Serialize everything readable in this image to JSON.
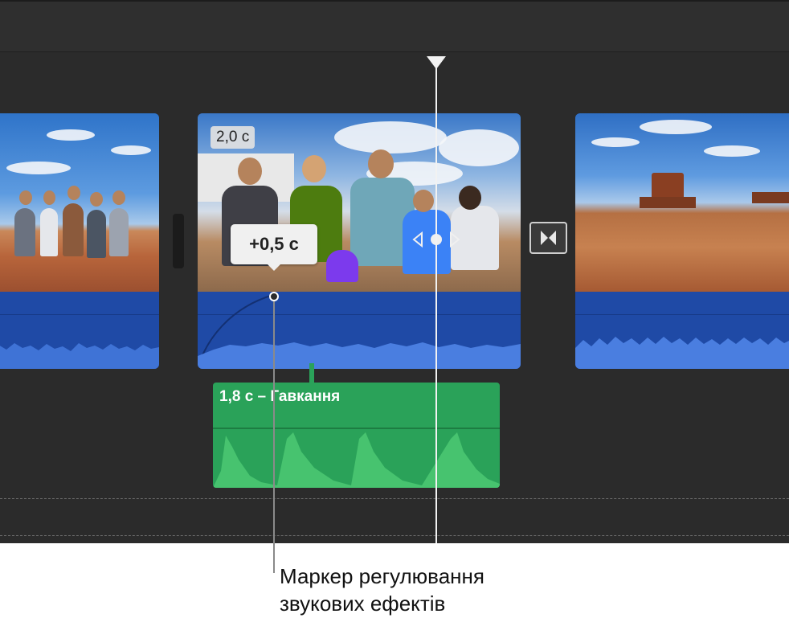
{
  "clips": {
    "center_duration": "2,0 с"
  },
  "tooltip": {
    "value": "+0,5 с"
  },
  "sound_effect": {
    "label": "1,8 с – Гавкання"
  },
  "callout": {
    "line1": "Маркер регулювання",
    "line2": "звукових ефектів"
  },
  "colors": {
    "timeline_bg": "#2b2b2b",
    "video_audio": "#1f4aa6",
    "sound_effect": "#2aa259",
    "playhead": "#f2f2f2"
  }
}
